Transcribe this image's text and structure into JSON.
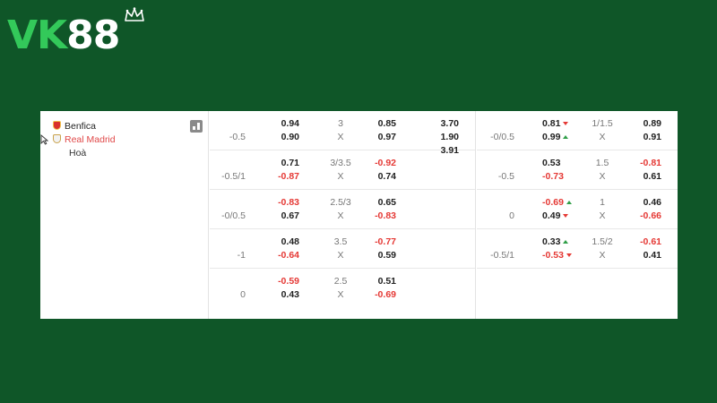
{
  "brand": {
    "logo_prefix": "VK",
    "logo_number": "88",
    "brand_color": "#33c95a"
  },
  "match": {
    "team1": "Benfica",
    "team2": "Real Madrid",
    "draw": "Hoà"
  },
  "one_x_two": [
    "3.70",
    "1.90",
    "3.91"
  ],
  "full_time_rows": [
    {
      "handicap": "-0.5",
      "home": "0.94",
      "away": "0.90",
      "line": "3",
      "x": "X",
      "over": "0.85",
      "under": "0.97"
    },
    {
      "handicap": "-0.5/1",
      "home": "0.71",
      "away": "-0.87",
      "line": "3/3.5",
      "x": "X",
      "over": "-0.92",
      "under": "0.74"
    },
    {
      "handicap": "-0/0.5",
      "home": "-0.83",
      "away": "0.67",
      "line": "2.5/3",
      "x": "X",
      "over": "0.65",
      "under": "-0.83"
    },
    {
      "handicap": "-1",
      "home": "0.48",
      "away": "-0.64",
      "line": "3.5",
      "x": "X",
      "over": "-0.77",
      "under": "0.59"
    },
    {
      "handicap": "0",
      "home": "-0.59",
      "away": "0.43",
      "line": "2.5",
      "x": "X",
      "over": "0.51",
      "under": "-0.69"
    }
  ],
  "half_time_rows": [
    {
      "handicap": "-0/0.5",
      "home": "0.81",
      "home_arrow": "down",
      "away": "0.99",
      "away_arrow": "up",
      "line": "1/1.5",
      "x": "X",
      "over": "0.89",
      "under": "0.91"
    },
    {
      "handicap": "-0.5",
      "home": "0.53",
      "home_arrow": "",
      "away": "-0.73",
      "away_arrow": "",
      "line": "1.5",
      "x": "X",
      "over": "-0.81",
      "under": "0.61"
    },
    {
      "handicap": "0",
      "home": "-0.69",
      "home_arrow": "up",
      "away": "0.49",
      "away_arrow": "down",
      "line": "1",
      "x": "X",
      "over": "0.46",
      "under": "-0.66"
    },
    {
      "handicap": "-0.5/1",
      "home": "0.33",
      "home_arrow": "up",
      "away": "-0.53",
      "away_arrow": "down",
      "line": "1.5/2",
      "x": "X",
      "over": "-0.61",
      "under": "0.41"
    }
  ],
  "colors": {
    "negative": "#e53935",
    "up": "#2e9e47",
    "down": "#e53935",
    "background": "#0f5628"
  }
}
